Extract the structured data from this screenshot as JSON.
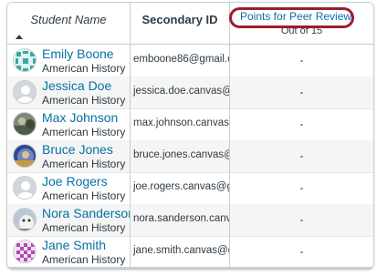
{
  "header": {
    "student_name": "Student Name",
    "secondary_id": "Secondary ID",
    "assignment": {
      "title": "Points for Peer Review",
      "points_label": "Out of 15"
    }
  },
  "students": [
    {
      "name": "Emily Boone",
      "section": "American History",
      "secondary_id": "emboone86@gmail.c",
      "score": "-",
      "avatar": "pattern-avatar"
    },
    {
      "name": "Jessica Doe",
      "section": "American History",
      "secondary_id": "jessica.doe.canvas@g",
      "score": "-",
      "avatar": "default-avatar"
    },
    {
      "name": "Max Johnson",
      "section": "American History",
      "secondary_id": "max.johnson.canvas@",
      "score": "-",
      "avatar": "photo-avatar"
    },
    {
      "name": "Bruce Jones",
      "section": "American History",
      "secondary_id": "bruce.jones.canvas@",
      "score": "-",
      "avatar": "photo-avatar"
    },
    {
      "name": "Joe Rogers",
      "section": "American History",
      "secondary_id": "joe.rogers.canvas@gr",
      "score": "-",
      "avatar": "default-avatar"
    },
    {
      "name": "Nora Sanderson",
      "section": "American History",
      "secondary_id": "nora.sanderson.canv",
      "score": "-",
      "avatar": "photo-avatar"
    },
    {
      "name": "Jane Smith",
      "section": "American History",
      "secondary_id": "jane.smith.canvas@g",
      "score": "-",
      "avatar": "pattern-avatar"
    }
  ],
  "colors": {
    "link": "#0770a3",
    "text": "#2d3b45",
    "highlight": "#9b1d2b",
    "border": "#c7cdd1"
  }
}
